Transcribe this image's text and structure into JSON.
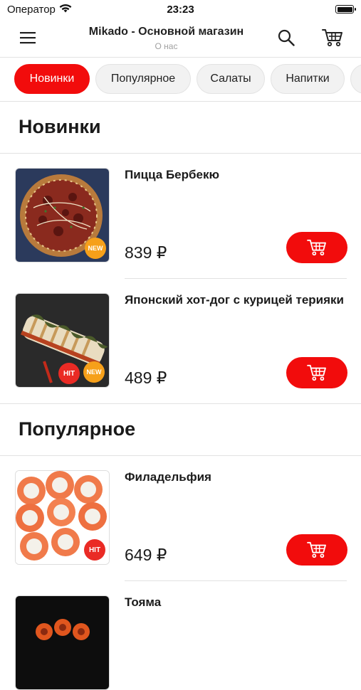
{
  "status_bar": {
    "carrier": "Оператор",
    "time": "23:23"
  },
  "nav": {
    "title": "Mikado - Основной магазин",
    "subtitle": "О нас"
  },
  "categories": [
    {
      "label": "Новинки",
      "active": true
    },
    {
      "label": "Популярное",
      "active": false
    },
    {
      "label": "Салаты",
      "active": false
    },
    {
      "label": "Напитки",
      "active": false
    }
  ],
  "sections": [
    {
      "title": "Новинки",
      "products": [
        {
          "name": "Пицца Бербекю",
          "price": "839 ₽",
          "badges": [
            "NEW"
          ],
          "image": "pizza-image"
        },
        {
          "name": "Японский хот-дог с курицей терияки",
          "price": "489 ₽",
          "badges": [
            "HIT",
            "NEW"
          ],
          "image": "hotdog-roll-image"
        }
      ]
    },
    {
      "title": "Популярное",
      "products": [
        {
          "name": "Филадельфия",
          "price": "649 ₽",
          "badges": [
            "HIT"
          ],
          "image": "philadelphia-roll-image"
        },
        {
          "name": "Тояма",
          "price": "",
          "badges": [],
          "image": "toyama-roll-image"
        }
      ]
    }
  ],
  "colors": {
    "accent": "#f20c0c",
    "new_badge": "#f6a01a",
    "hit_badge": "#ea2b25"
  }
}
